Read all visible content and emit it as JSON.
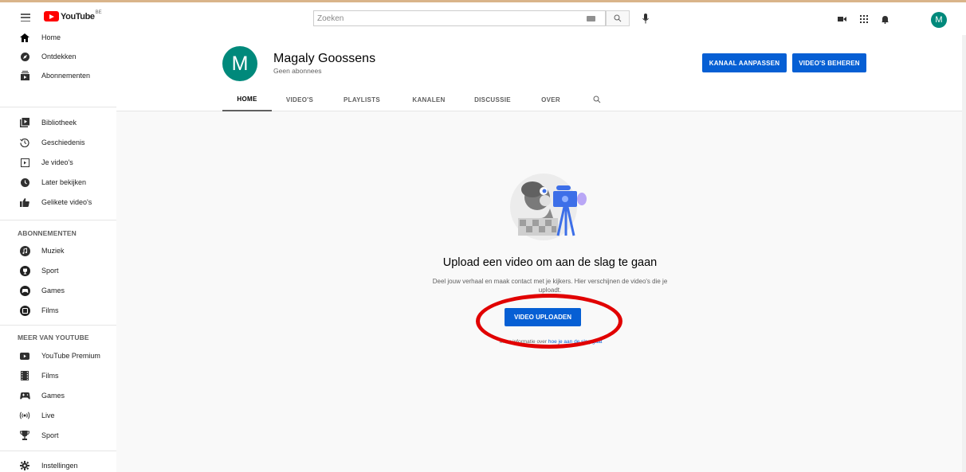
{
  "masthead": {
    "logo_word": "YouTube",
    "logo_country": "BE",
    "search_placeholder": "Zoeken",
    "avatar_letter": "M"
  },
  "sidebar": {
    "main": [
      {
        "label": "Home",
        "icon": "home-icon"
      },
      {
        "label": "Ontdekken",
        "icon": "explore-icon"
      },
      {
        "label": "Abonnementen",
        "icon": "subscriptions-icon"
      }
    ],
    "library": [
      {
        "label": "Bibliotheek",
        "icon": "library-icon"
      },
      {
        "label": "Geschiedenis",
        "icon": "history-icon"
      },
      {
        "label": "Je video's",
        "icon": "your-videos-icon"
      },
      {
        "label": "Later bekijken",
        "icon": "watch-later-icon"
      },
      {
        "label": "Gelikete video's",
        "icon": "liked-videos-icon"
      }
    ],
    "subscriptions_heading": "ABONNEMENTEN",
    "subscriptions": [
      {
        "label": "Muziek",
        "icon": "music-channel-icon"
      },
      {
        "label": "Sport",
        "icon": "sport-channel-icon"
      },
      {
        "label": "Games",
        "icon": "games-channel-icon"
      },
      {
        "label": "Films",
        "icon": "films-channel-icon"
      }
    ],
    "more_heading": "MEER VAN YOUTUBE",
    "more": [
      {
        "label": "YouTube Premium",
        "icon": "youtube-premium-icon"
      },
      {
        "label": "Films",
        "icon": "films-icon"
      },
      {
        "label": "Games",
        "icon": "games-icon"
      },
      {
        "label": "Live",
        "icon": "live-icon"
      },
      {
        "label": "Sport",
        "icon": "trophy-icon"
      }
    ],
    "settings": {
      "label": "Instellingen",
      "icon": "gear-icon"
    }
  },
  "channel": {
    "avatar_letter": "M",
    "name": "Magaly Goossens",
    "subscribers": "Geen abonnees",
    "customize_button": "KANAAL AANPASSEN",
    "manage_button": "VIDEO'S BEHEREN",
    "tabs": [
      "HOME",
      "VIDEO'S",
      "PLAYLISTS",
      "KANALEN",
      "DISCUSSIE",
      "OVER"
    ],
    "active_tab": "HOME"
  },
  "empty_state": {
    "title": "Upload een video om aan de slag te gaan",
    "description": "Deel jouw verhaal en maak contact met je kijkers. Hier verschijnen de video's die je uploadt.",
    "upload_button": "VIDEO UPLOADEN",
    "learn_more_prefix": "Meer informatie over ",
    "learn_more_link": "hoe je aan de slag gaat"
  },
  "colors": {
    "accent_blue": "#065fd4",
    "avatar_teal": "#00897b",
    "youtube_red": "#ff0000",
    "annotation_red": "#e10000"
  }
}
